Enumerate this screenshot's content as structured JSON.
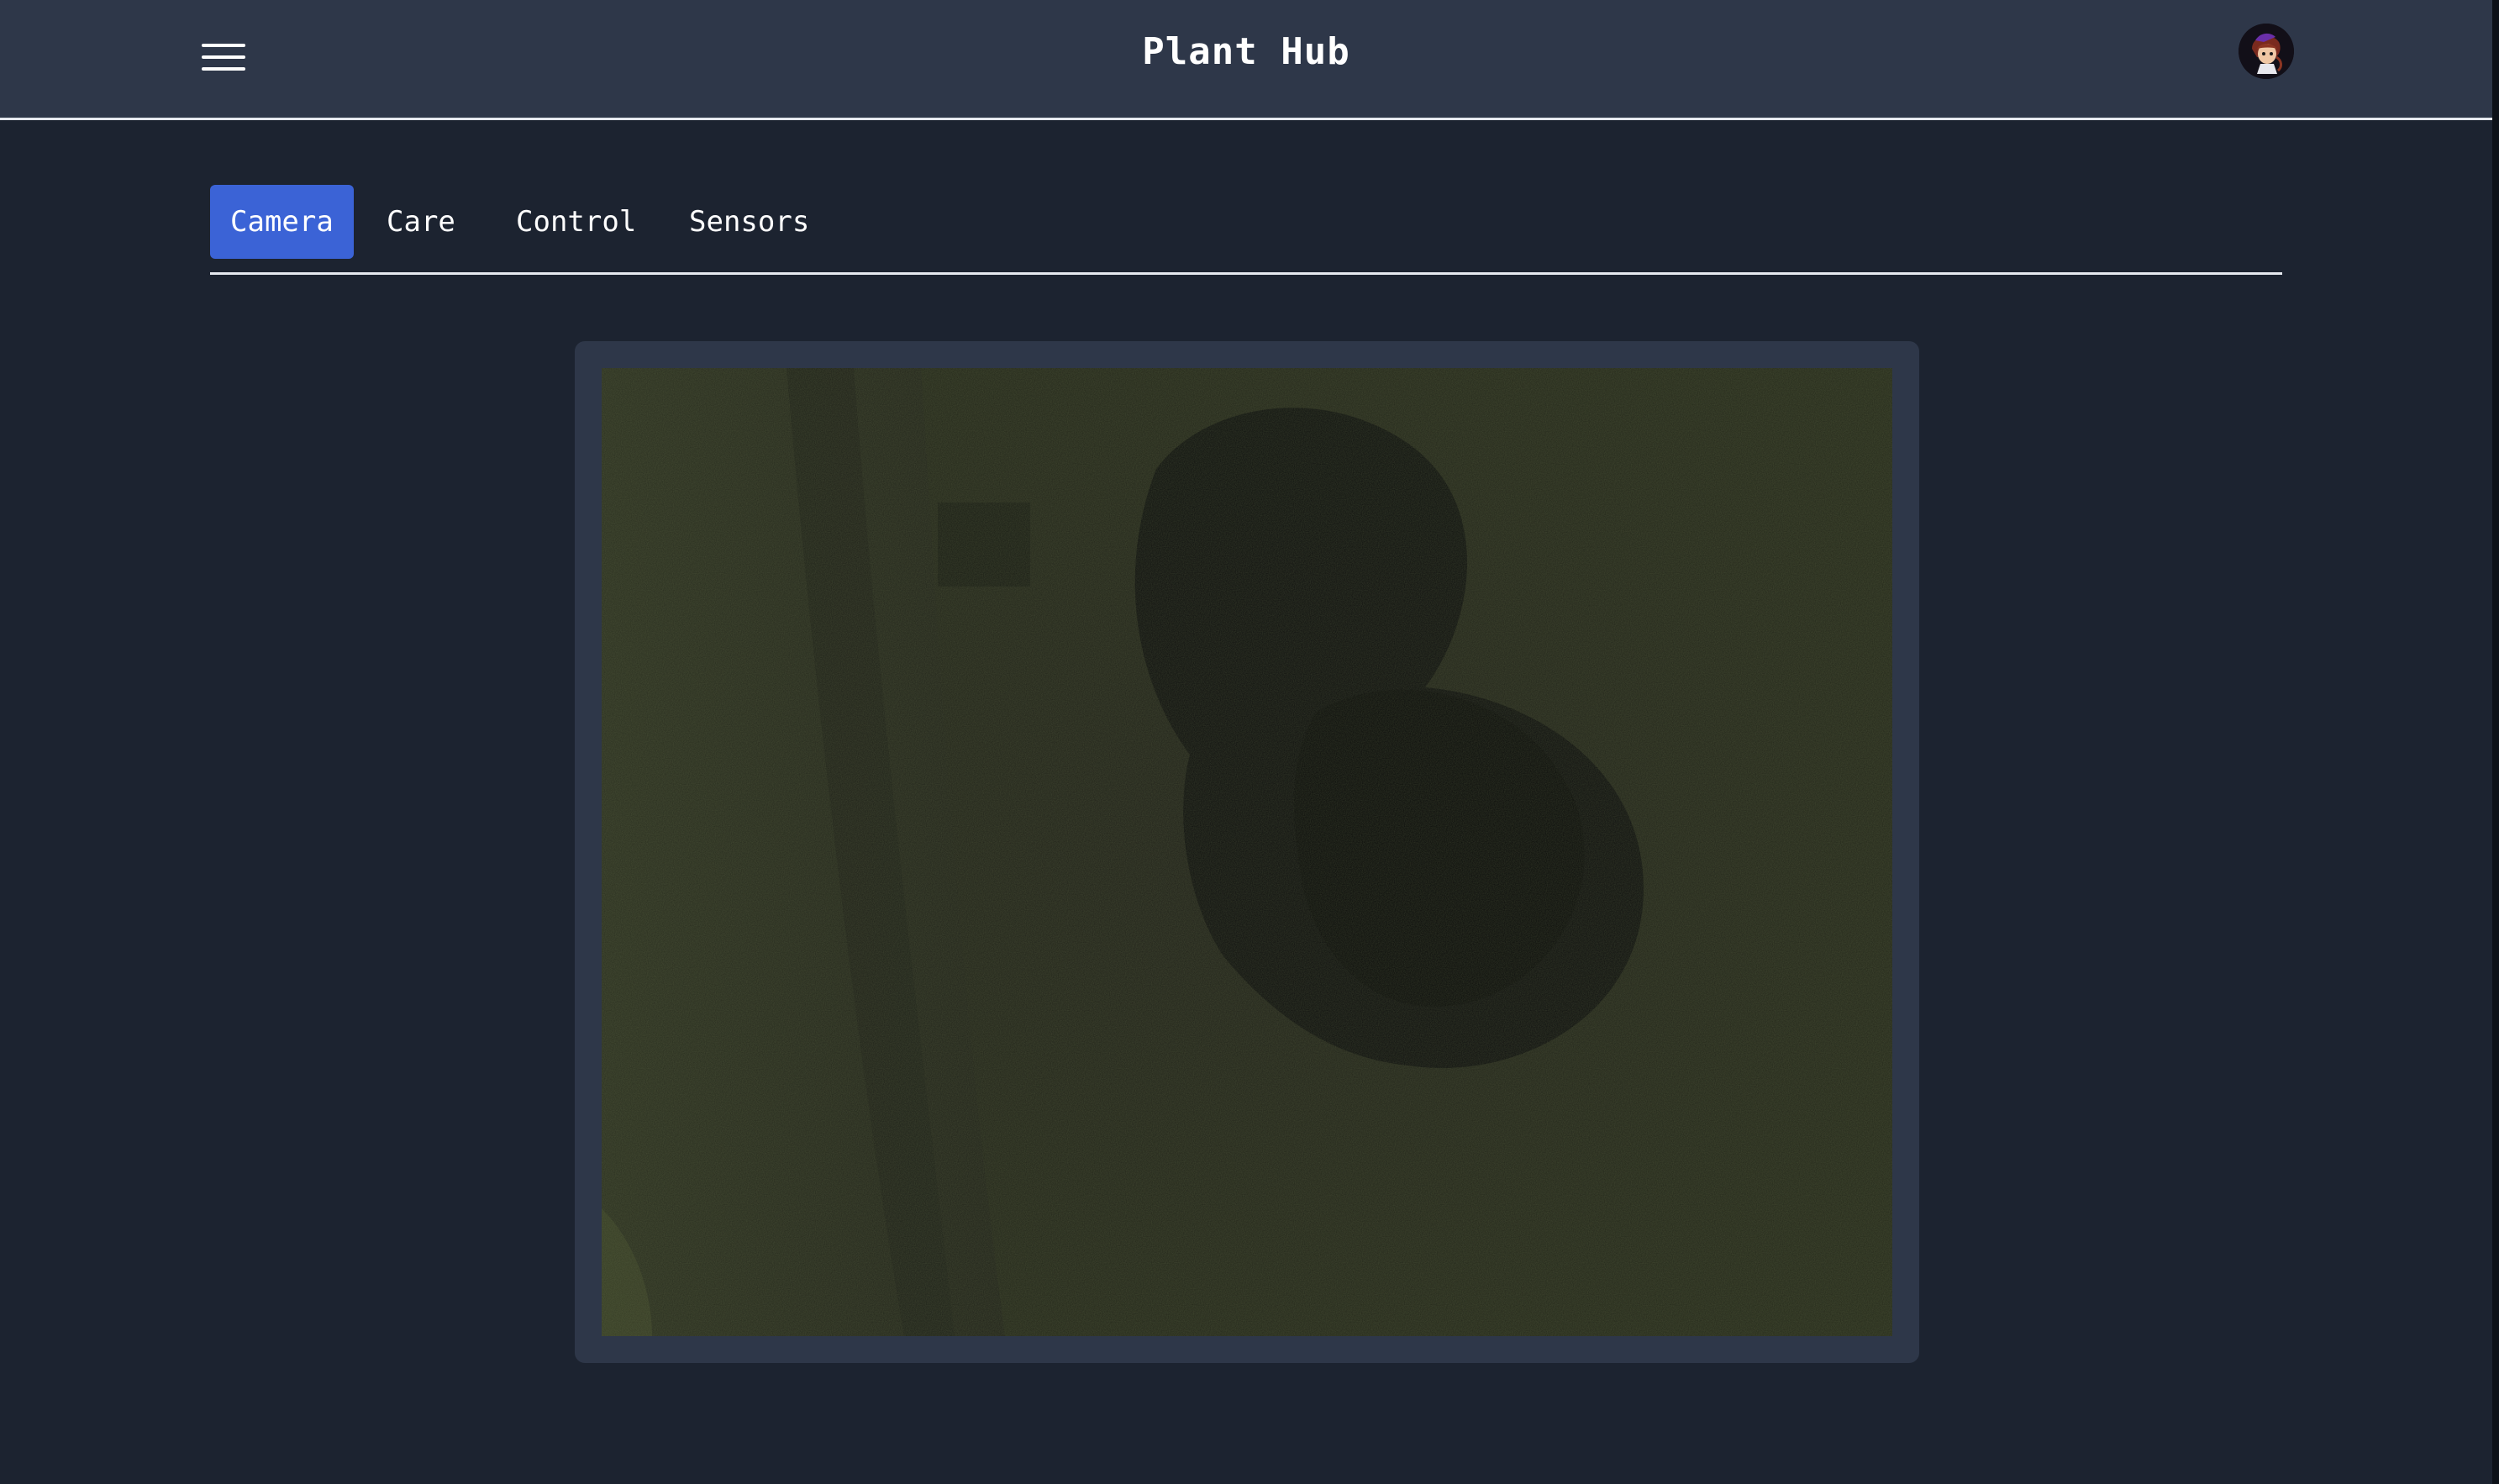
{
  "header": {
    "title": "Plant Hub",
    "menu_icon": "hamburger-menu-icon",
    "avatar_icon": "user-avatar-icon"
  },
  "tabs": [
    {
      "label": "Camera",
      "active": true
    },
    {
      "label": "Care",
      "active": false
    },
    {
      "label": "Control",
      "active": false
    },
    {
      "label": "Sensors",
      "active": false
    }
  ],
  "camera": {
    "feed_icon": "camera-feed-image"
  },
  "colors": {
    "background": "#1c2330",
    "panel": "#2e3749",
    "accent": "#3b63d6",
    "text": "#ffffff"
  }
}
